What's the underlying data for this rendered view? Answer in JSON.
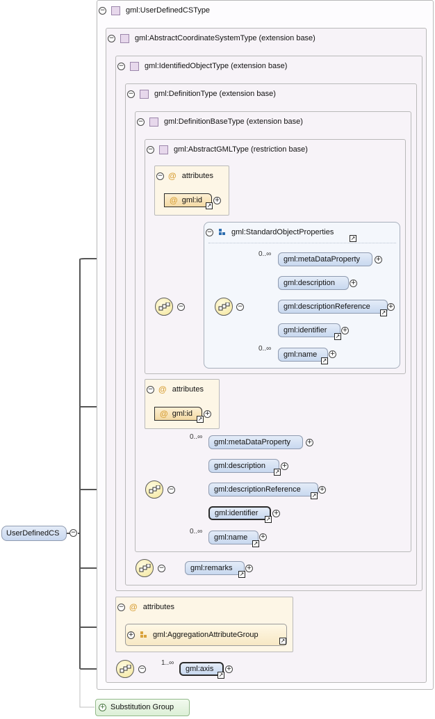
{
  "diagram": {
    "root_element": "UserDefinedCS",
    "types": {
      "user_defined_cs_type": "gml:UserDefinedCSType",
      "abstract_cs_type": "gml:AbstractCoordinateSystemType (extension base)",
      "identified_object_type": "gml:IdentifiedObjectType (extension base)",
      "definition_type": "gml:DefinitionType (extension base)",
      "definition_base_type": "gml:DefinitionBaseType (extension base)",
      "abstract_gml_type": "gml:AbstractGMLType (restriction base)"
    },
    "attributes_label": "attributes",
    "gml_id": "gml:id",
    "standard_object_properties": {
      "title": "gml:StandardObjectProperties",
      "elements": [
        {
          "name": "gml:metaDataProperty",
          "occurs": "0..∞"
        },
        {
          "name": "gml:description",
          "occurs": ""
        },
        {
          "name": "gml:descriptionReference",
          "occurs": ""
        },
        {
          "name": "gml:identifier",
          "occurs": ""
        },
        {
          "name": "gml:name",
          "occurs": "0..∞"
        }
      ]
    },
    "definition_base_elements": [
      {
        "name": "gml:metaDataProperty",
        "occurs": "0..∞"
      },
      {
        "name": "gml:description",
        "occurs": ""
      },
      {
        "name": "gml:descriptionReference",
        "occurs": ""
      },
      {
        "name": "gml:identifier",
        "occurs": ""
      },
      {
        "name": "gml:name",
        "occurs": "0..∞"
      }
    ],
    "remarks": "gml:remarks",
    "aggregation_attribute_group": "gml:AggregationAttributeGroup",
    "axis": {
      "name": "gml:axis",
      "occurs": "1..∞"
    },
    "substitution_group": "Substitution Group",
    "glyphs": {
      "collapse": "⊖",
      "expand": "+",
      "minus": "−",
      "link": "↗"
    },
    "colors": {
      "type_box": "#f7f3f8",
      "attributes_box": "#fdf6e6",
      "element_pill": "#c8d8ef",
      "substitution_group": "#dcefd6",
      "connector": "#555555"
    }
  }
}
